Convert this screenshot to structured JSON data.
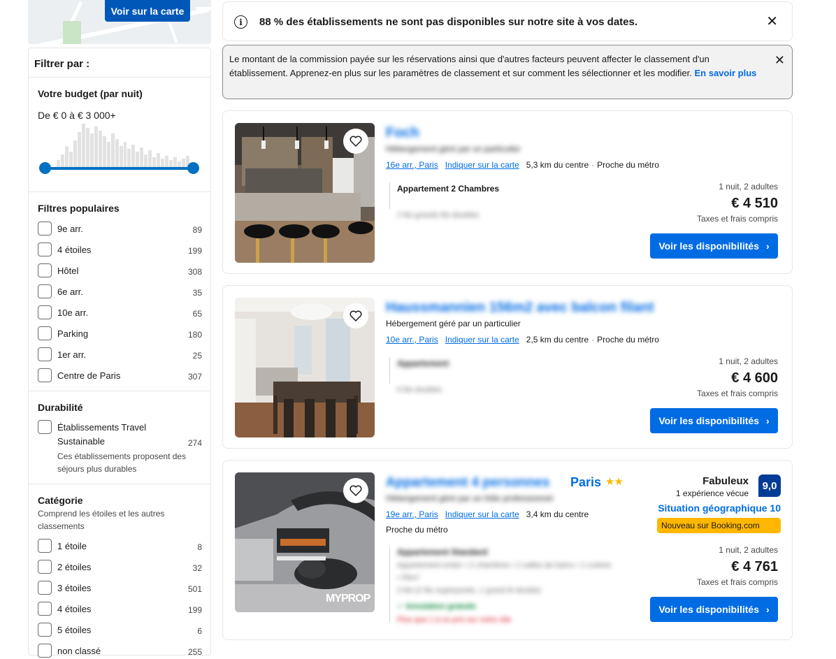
{
  "map": {
    "button_label": "Voir sur la carte"
  },
  "sidebar": {
    "title": "Filtrer par :",
    "budget": {
      "title": "Votre budget (par nuit)",
      "range": "De € 0 à € 3 000+"
    },
    "popular": {
      "title": "Filtres populaires",
      "items": [
        {
          "label": "9e arr.",
          "count": "89"
        },
        {
          "label": "4 étoiles",
          "count": "199"
        },
        {
          "label": "Hôtel",
          "count": "308"
        },
        {
          "label": "6e arr.",
          "count": "35"
        },
        {
          "label": "10e arr.",
          "count": "65"
        },
        {
          "label": "Parking",
          "count": "180"
        },
        {
          "label": "1er arr.",
          "count": "25"
        },
        {
          "label": "Centre de Paris",
          "count": "307"
        }
      ]
    },
    "durability": {
      "title": "Durabilité",
      "item_line1": "Établissements Travel",
      "item_line2": "Sustainable",
      "count": "274",
      "note_line1": "Ces établissements proposent des",
      "note_line2": "séjours plus durables"
    },
    "category": {
      "title": "Catégorie",
      "sub_line1": "Comprend les étoiles et les autres",
      "sub_line2": "classements",
      "items": [
        {
          "label": "1 étoile",
          "count": "8"
        },
        {
          "label": "2 étoiles",
          "count": "32"
        },
        {
          "label": "3 étoiles",
          "count": "501"
        },
        {
          "label": "4 étoiles",
          "count": "199"
        },
        {
          "label": "5 étoiles",
          "count": "6"
        },
        {
          "label": "non classé",
          "count": "255"
        }
      ]
    }
  },
  "banners": {
    "availability": "88 % des établissements ne sont pas disponibles sur notre site à vos dates.",
    "commission": "Le montant de la commission payée sur les réservations ainsi que d'autres facteurs peuvent affecter le classement d'un établissement. Apprenez-en plus sur les paramètres de classement et sur comment les sélectionner et les modifier.",
    "commission_link": "En savoir plus"
  },
  "listings": [
    {
      "title": "Foch",
      "host": "Hébergement géré par un particulier",
      "district": "16e arr., Paris",
      "map_link": "Indiquer sur la carte",
      "distance": "5,3 km du centre",
      "extra": "Proche du métro",
      "room": "Appartement 2 Chambres",
      "beds": "2 lits grands lits doubles",
      "nights": "1 nuit, 2 adultes",
      "price": "€ 4 510",
      "taxes": "Taxes et frais compris",
      "cta": "Voir les disponibilités"
    },
    {
      "title": "Haussmannien 156m2 avec balcon filant",
      "host": "Hébergement géré par un particulier",
      "district": "10e arr., Paris",
      "map_link": "Indiquer sur la carte",
      "distance": "2,5 km du centre",
      "extra": "Proche du métro",
      "room": "Appartement",
      "beds": "6 lits doubles",
      "nights": "1 nuit, 2 adultes",
      "price": "€ 4 600",
      "taxes": "Taxes et frais compris",
      "cta": "Voir les disponibilités"
    },
    {
      "title": "Appartement 4 personnes",
      "city": "Paris",
      "stars": "★★",
      "host": "Hébergement géré par un hôte professionnel",
      "district": "19e arr., Paris",
      "map_link": "Indiquer sur la carte",
      "distance": "3,4 km du centre",
      "extra": "Proche du métro",
      "room": "Appartement Standard",
      "room_detail_1": "Appartement entier • 2 chambres • 2 salles de bains • 1 cuisine",
      "room_detail_2": "• 55m²",
      "beds": "3 lits (2 lits superposés, 1 grand lit double)",
      "cancel": "✓ Annulation gratuite",
      "warning": "Plus que 1 à ce prix sur notre site",
      "score_word": "Fabuleux",
      "score_reviews": "1 expérience vécue",
      "score": "9,0",
      "location_score": "Situation géographique 10",
      "new_badge": "Nouveau sur Booking.com",
      "nights": "1 nuit, 2 adultes",
      "price": "€ 4 761",
      "taxes": "Taxes et frais compris",
      "cta": "Voir les disponibilités",
      "watermark": "MYPROP"
    }
  ],
  "colors": {
    "primary": "#006ce4",
    "dark_blue": "#003b95",
    "badge_yellow": "#ffb700"
  }
}
